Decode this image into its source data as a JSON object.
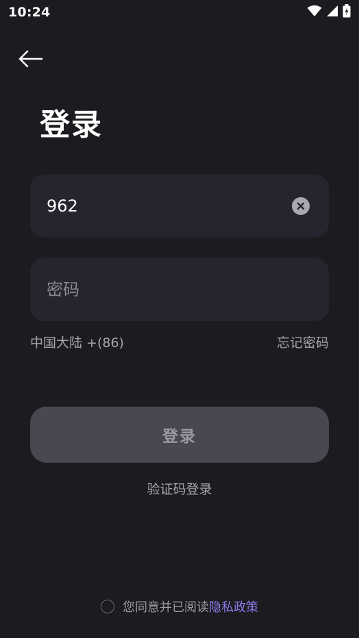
{
  "status_bar": {
    "time": "10:24",
    "icons": [
      "wifi-icon",
      "signal-icon",
      "battery-charging-icon"
    ]
  },
  "header": {
    "back_icon": "arrow-left-icon",
    "title": "登录"
  },
  "form": {
    "phone_value": "962",
    "clear_icon": "close-circle-icon",
    "password_placeholder": "密码",
    "region": "中国大陆 +(86)",
    "forgot_password": "忘记密码",
    "login_button": "登录",
    "sms_login": "验证码登录"
  },
  "agreement": {
    "text": "您同意并已阅读",
    "policy_link": "隐私政策",
    "checked": false
  },
  "colors": {
    "background": "#1b1b20",
    "field_background": "#26242f",
    "button_background": "#4a4752",
    "link_accent": "#8e7be6"
  }
}
